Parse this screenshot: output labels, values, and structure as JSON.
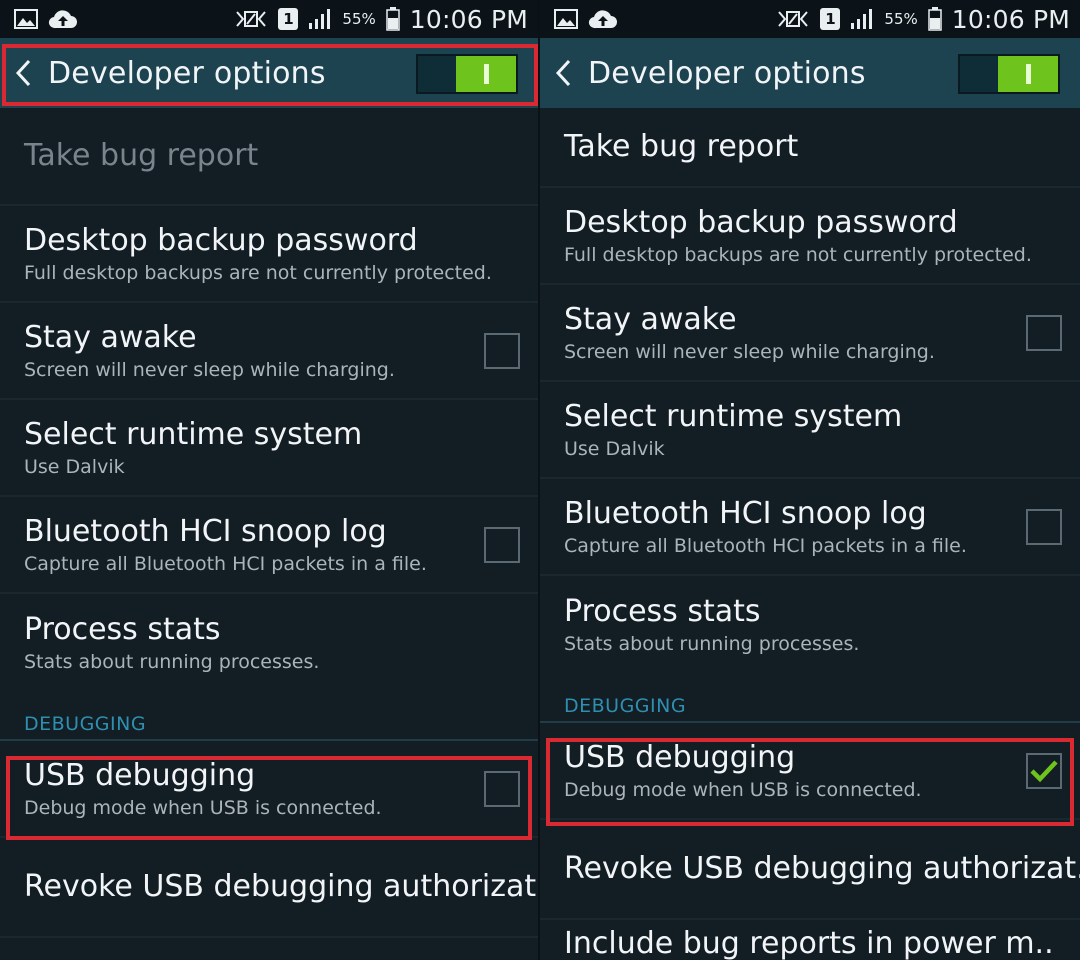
{
  "status_bar": {
    "icons": [
      "image-icon",
      "cloud-upload-icon",
      "nfc-icon",
      "sim-icon",
      "signal-icon",
      "battery-icon"
    ],
    "sim_number": "1",
    "battery_percent": "55%",
    "time": "10:06 PM"
  },
  "header": {
    "title": "Developer options",
    "toggle_on": true
  },
  "colors": {
    "header_bg": "#1d4350",
    "toggle_on": "#6ec41d",
    "section_header": "#2f8fb1",
    "highlight": "#d92a34",
    "check": "#6ec41d"
  },
  "panels": [
    {
      "id": "left",
      "items": [
        {
          "title": "Take bug report",
          "subtitle": "",
          "disabled": true,
          "checkbox": null
        },
        {
          "title": "Desktop backup password",
          "subtitle": "Full desktop backups are not currently protected."
        },
        {
          "title": "Stay awake",
          "subtitle": "Screen will never sleep while charging.",
          "checkbox": false
        },
        {
          "title": "Select runtime system",
          "subtitle": "Use Dalvik"
        },
        {
          "title": "Bluetooth HCI snoop log",
          "subtitle": "Capture all Bluetooth HCI packets in a file.",
          "checkbox": false
        },
        {
          "title": "Process stats",
          "subtitle": "Stats about running processes."
        }
      ],
      "section": "DEBUGGING",
      "debug_items": [
        {
          "title": "USB debugging",
          "subtitle": "Debug mode when USB is connected.",
          "checkbox": false
        },
        {
          "title": "Revoke USB debugging authorizat..",
          "subtitle": ""
        }
      ]
    },
    {
      "id": "right",
      "items": [
        {
          "title": "Take bug report",
          "subtitle": ""
        },
        {
          "title": "Desktop backup password",
          "subtitle": "Full desktop backups are not currently protected."
        },
        {
          "title": "Stay awake",
          "subtitle": "Screen will never sleep while charging.",
          "checkbox": false
        },
        {
          "title": "Select runtime system",
          "subtitle": "Use Dalvik"
        },
        {
          "title": "Bluetooth HCI snoop log",
          "subtitle": "Capture all Bluetooth HCI packets in a file.",
          "checkbox": false
        },
        {
          "title": "Process stats",
          "subtitle": "Stats about running processes."
        }
      ],
      "section": "DEBUGGING",
      "debug_items": [
        {
          "title": "USB debugging",
          "subtitle": "Debug mode when USB is connected.",
          "checkbox": true
        },
        {
          "title": "Revoke USB debugging authorizat..",
          "subtitle": ""
        },
        {
          "title": "Include bug reports in power m..",
          "subtitle": ""
        }
      ]
    }
  ]
}
